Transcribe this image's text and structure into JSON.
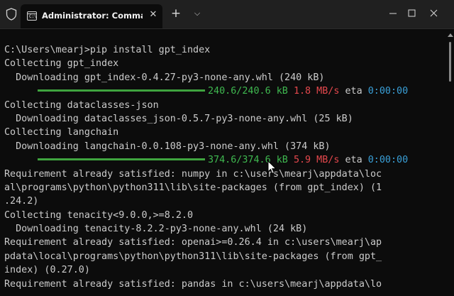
{
  "window": {
    "tab_title": "Administrator: Command Pro",
    "tab_icon": "cmd-icon",
    "tab_icon_text": "C:\\",
    "close_tab_glyph": "✕",
    "new_tab_glyph": "+",
    "dropdown_glyph": "⌵"
  },
  "console": {
    "lines": [
      {
        "text": "C:\\Users\\mearj>pip install gpt_index"
      },
      {
        "text": "Collecting gpt_index"
      },
      {
        "text": "  Downloading gpt_index-0.4.27-py3-none-any.whl (240 kB)"
      },
      {
        "progress": "240.6/240.6 kB",
        "speed": "1.8 MB/s",
        "eta_label": "eta",
        "eta": "0:00:00"
      },
      {
        "text": "Collecting dataclasses-json"
      },
      {
        "text": "  Downloading dataclasses_json-0.5.7-py3-none-any.whl (25 kB)"
      },
      {
        "text": "Collecting langchain"
      },
      {
        "text": "  Downloading langchain-0.0.108-py3-none-any.whl (374 kB)"
      },
      {
        "progress": "374.6/374.6 kB",
        "speed": "5.9 MB/s",
        "eta_label": "eta",
        "eta": "0:00:00"
      },
      {
        "text": "Requirement already satisfied: numpy in c:\\users\\mearj\\appdata\\loc"
      },
      {
        "text": "al\\programs\\python\\python311\\lib\\site-packages (from gpt_index) (1"
      },
      {
        "text": ".24.2)"
      },
      {
        "text": "Collecting tenacity<9.0.0,>=8.2.0"
      },
      {
        "text": "  Downloading tenacity-8.2.2-py3-none-any.whl (24 kB)"
      },
      {
        "text": "Requirement already satisfied: openai>=0.26.4 in c:\\users\\mearj\\ap"
      },
      {
        "text": "pdata\\local\\programs\\python\\python311\\lib\\site-packages (from gpt_"
      },
      {
        "text": "index) (0.27.0)"
      },
      {
        "text": "Requirement already satisfied: pandas in c:\\users\\mearj\\appdata\\lo"
      }
    ]
  },
  "colors": {
    "background": "#0c0c0c",
    "titlebar": "#202020",
    "text": "#cccccc",
    "progress_green": "#3fb950",
    "speed_red": "#e5484d",
    "eta_blue": "#3aa0d8"
  }
}
